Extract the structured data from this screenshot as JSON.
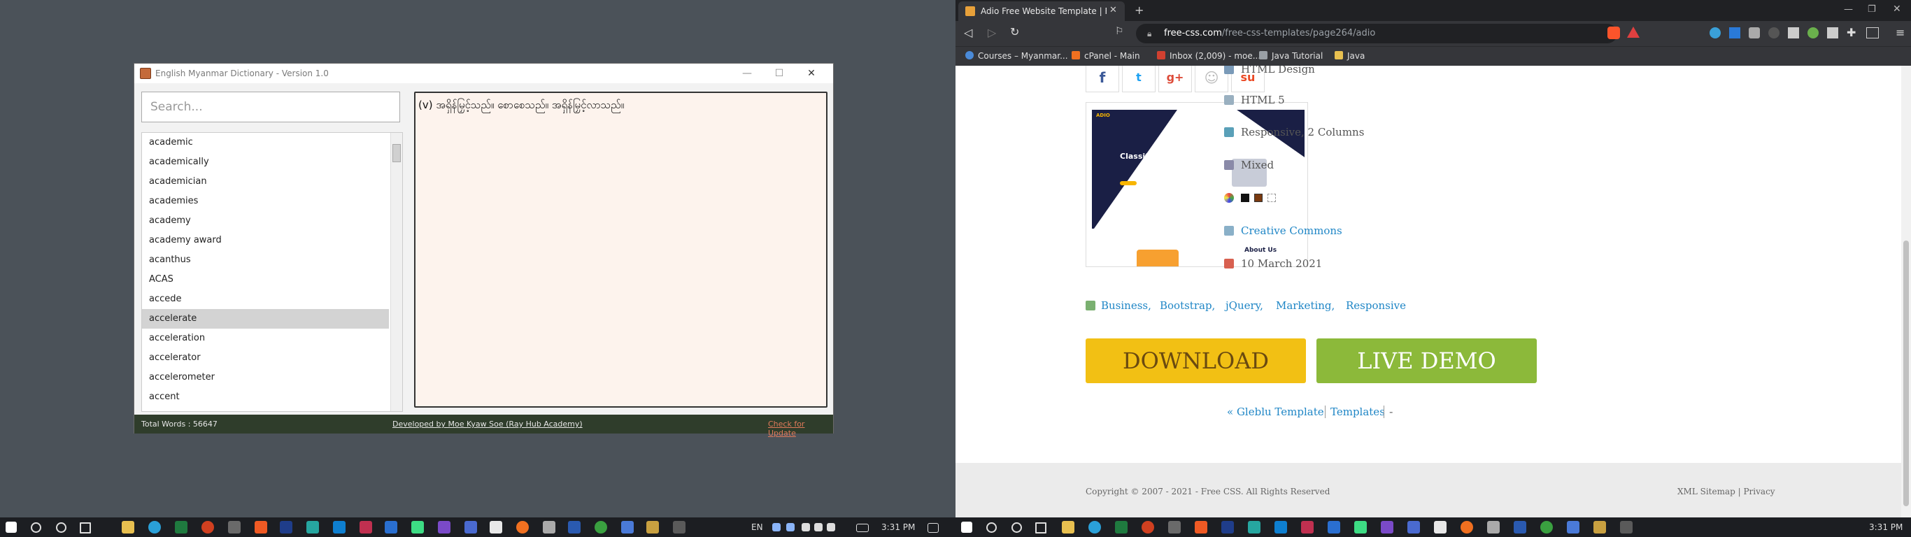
{
  "dictionary": {
    "title": "English Myanmar Dictionary - Version 1.0",
    "search_placeholder": "Search...",
    "words": [
      "academic",
      "academically",
      "academician",
      "academies",
      "academy",
      "academy award",
      "acanthus",
      "ACAS",
      "accede",
      "accelerate",
      "acceleration",
      "accelerator",
      "accelerometer",
      "accent"
    ],
    "selected_word": "accelerate",
    "definition": "(v) အရှိန်မြှင့်သည်။ စောစေသည်။ အရှိန်မြှင့်လာသည်။",
    "total_words": "Total Words : 56647",
    "developer_credit": "Developed by Moe Kyaw Soe (Ray Hub Academy)",
    "update_link": "Check for Update",
    "window_buttons": {
      "minimize": "—",
      "maximize": "☐",
      "close": "✕"
    }
  },
  "left_taskbar": {
    "language": "EN",
    "time": "3:31 PM"
  },
  "browser": {
    "tab_title": "Adio Free Website Template | Free",
    "url_domain": "free-css.com",
    "url_path": "/free-css-templates/page264/adio",
    "bookmarks": [
      "Courses – Myanmar...",
      "cPanel - Main",
      "Inbox (2,009) - moe...",
      "Java Tutorial",
      "Java"
    ],
    "meta": {
      "design": "HTML Design",
      "version": "HTML 5",
      "layout": "Responsive, 2 Columns",
      "color": "Mixed",
      "license": "Creative Commons",
      "date": "10 March 2021"
    },
    "social": [
      "f",
      "t",
      "g+",
      "☺",
      "su"
    ],
    "thumbnail": {
      "logo": "ADIO",
      "headline": "Classified Ads",
      "section": "About Us"
    },
    "tags": [
      "Business,",
      "Bootstrap,",
      "jQuery,",
      "Marketing,",
      "Responsive"
    ],
    "download_label": "DOWNLOAD",
    "demo_label": "LIVE DEMO",
    "prev_link": "« Gleblu Template",
    "templates_link": "Templates",
    "separator": "-",
    "copyright": "Copyright © 2007 - 2021 - Free CSS. All Rights Reserved",
    "footer_links": "XML Sitemap | Privacy",
    "colors": {
      "download": "#f2c014",
      "demo": "#8cb93a",
      "link": "#1f86c6"
    }
  },
  "right_taskbar": {
    "time": "3:31 PM"
  }
}
